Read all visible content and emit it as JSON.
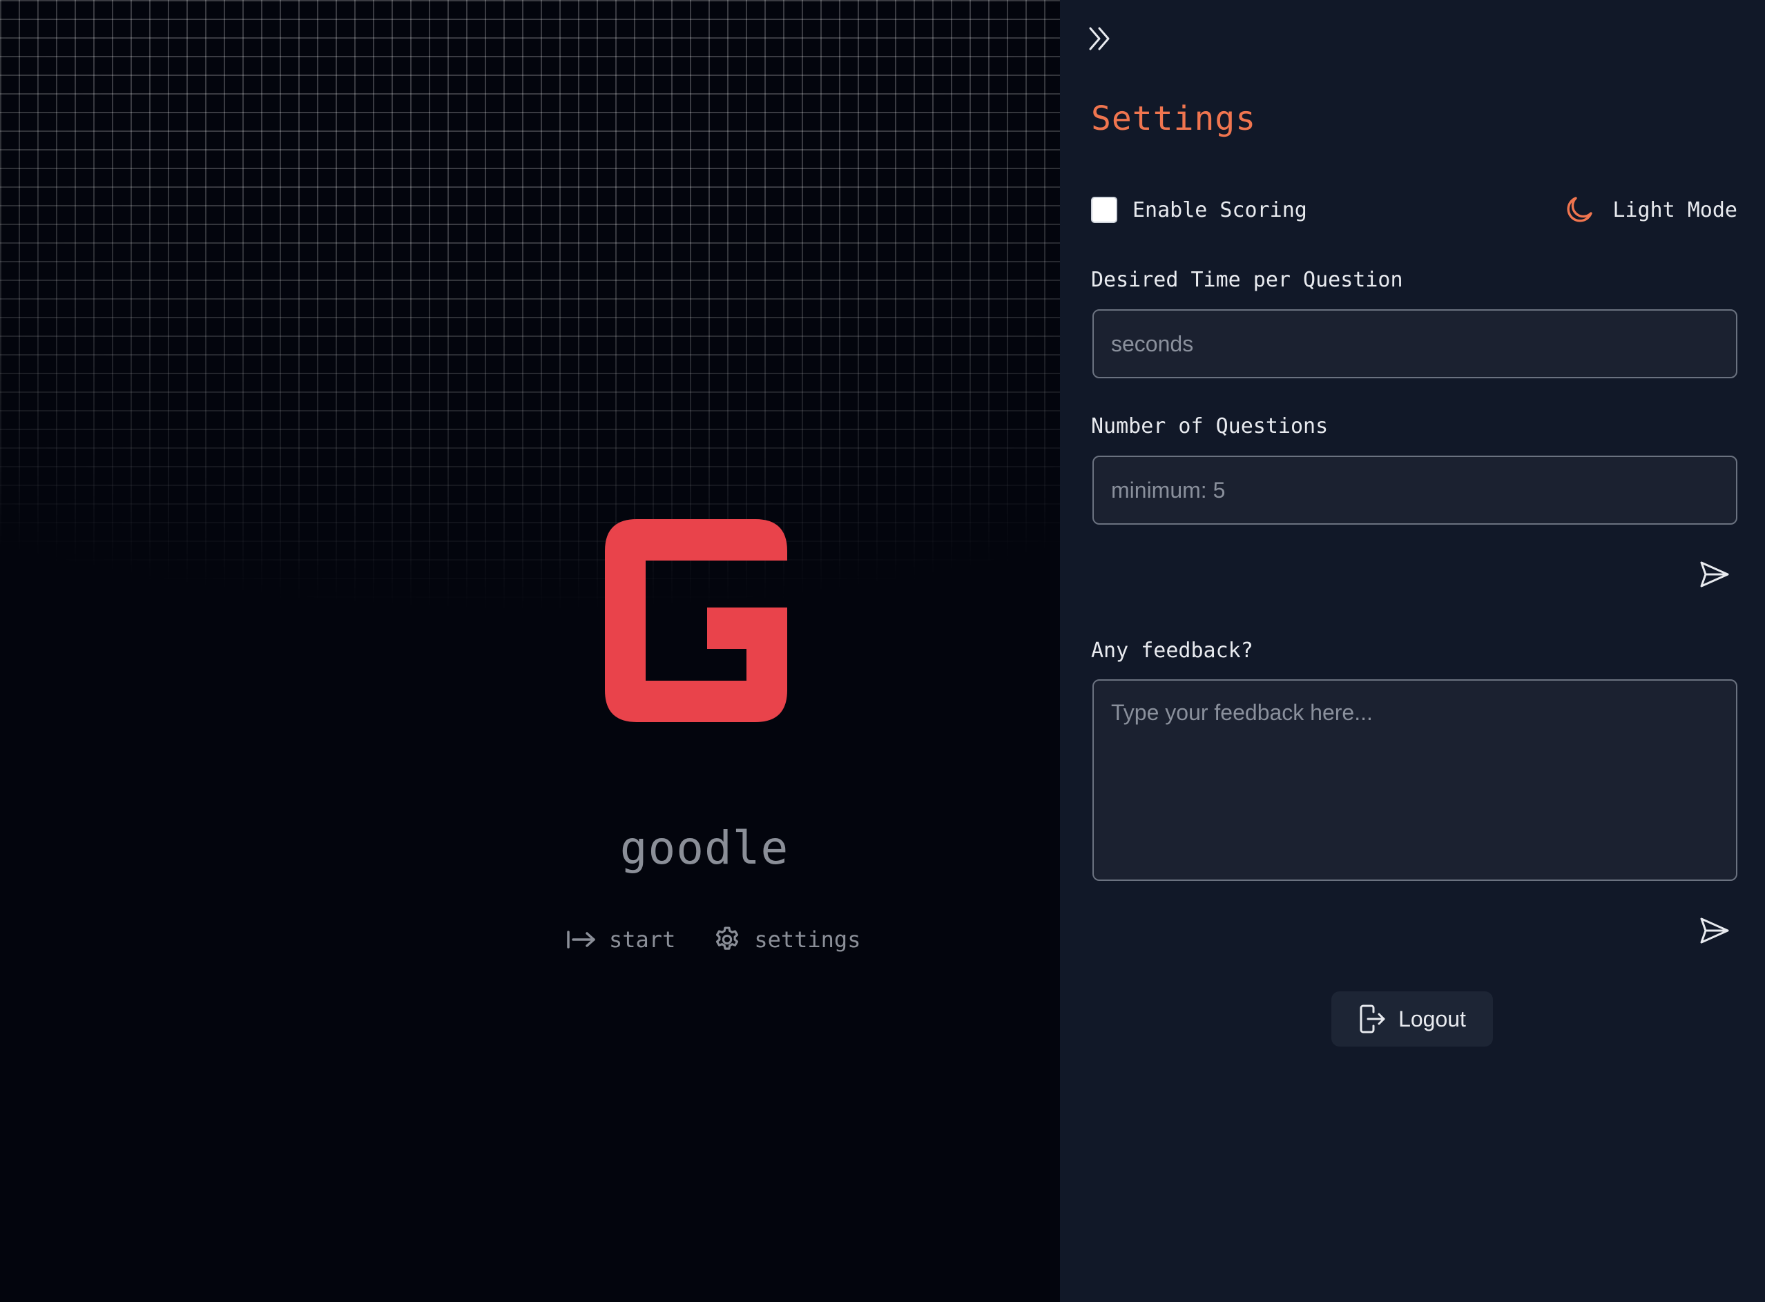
{
  "colors": {
    "background": "#03050d",
    "panel": "#111828",
    "accent": "#f0754f",
    "logo_red": "#e9434b",
    "muted_text": "#8b8f98",
    "input_bg": "#1b2130",
    "input_border": "#6b7280"
  },
  "landing": {
    "logo_icon": "g-logo",
    "brand_name": "goodle",
    "nav": [
      {
        "label": "start",
        "icon": "arrow-right-to-bar-icon"
      },
      {
        "label": "settings",
        "icon": "gear-icon"
      }
    ]
  },
  "settings": {
    "collapse_icon": "chevrons-right-icon",
    "title": "Settings",
    "enable_scoring": {
      "label": "Enable Scoring",
      "checked": false
    },
    "theme_toggle": {
      "label": "Light Mode",
      "icon": "moon-icon"
    },
    "time_per_question": {
      "label": "Desired Time per Question",
      "placeholder": "seconds",
      "value": ""
    },
    "number_of_questions": {
      "label": "Number of Questions",
      "placeholder": "minimum: 5",
      "value": ""
    },
    "submit_icon": "send-icon",
    "feedback": {
      "label": "Any feedback?",
      "placeholder": "Type your feedback here...",
      "value": ""
    },
    "logout": {
      "label": "Logout",
      "icon": "logout-icon"
    }
  }
}
